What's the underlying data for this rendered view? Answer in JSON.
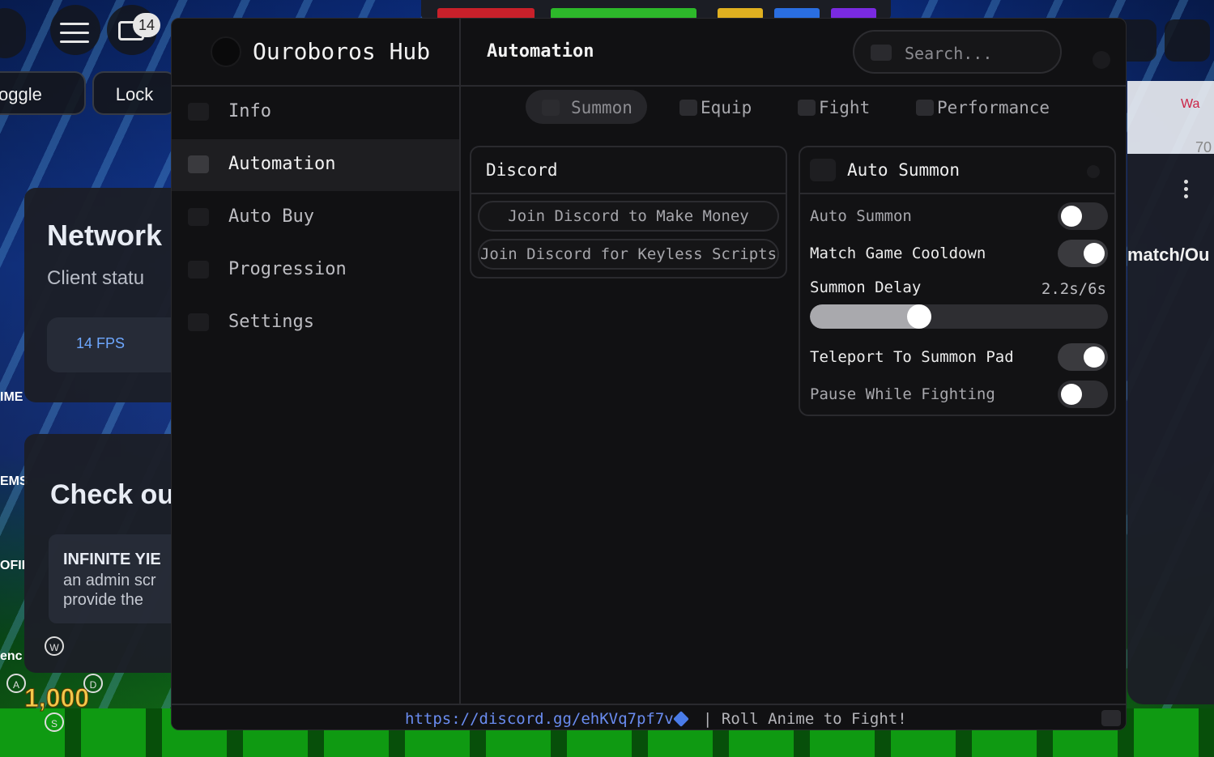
{
  "roblox": {
    "chat_badge": "14",
    "toggle_label": "oggle",
    "lock_label": "Lock",
    "network_title": "Network",
    "network_subtitle": "Client statu",
    "fps_label": "14 FPS",
    "check_title": "Check ou",
    "infinite_yield_title": "INFINITE YIE",
    "infinite_yield_line1": "an admin scr",
    "infinite_yield_line2": "provide the",
    "coins": "1,000",
    "key_w": "W",
    "key_a": "A",
    "key_d": "D",
    "key_s": "S",
    "side_label_ime": "IME",
    "side_label_ems": "EMS",
    "side_label_ofi": "OFII",
    "side_label_enc": "enc",
    "right_wa": "Wa",
    "right_70": "70",
    "right_match": "match/Ou"
  },
  "hub": {
    "title": "Ouroboros Hub",
    "page_title": "Automation",
    "search_placeholder": "Search...",
    "nav": [
      {
        "label": "Info",
        "icon": "info-icon",
        "active": false
      },
      {
        "label": "Automation",
        "icon": "automation-icon",
        "active": true
      },
      {
        "label": "Auto Buy",
        "icon": "cart-icon",
        "active": false
      },
      {
        "label": "Progression",
        "icon": "chart-icon",
        "active": false
      },
      {
        "label": "Settings",
        "icon": "gear-icon",
        "active": false
      }
    ],
    "tabs": [
      {
        "label": "Summon",
        "icon": "summon-icon",
        "active": true
      },
      {
        "label": "Equip",
        "icon": "equip-icon",
        "active": false
      },
      {
        "label": "Fight",
        "icon": "fight-icon",
        "active": false
      },
      {
        "label": "Performance",
        "icon": "performance-icon",
        "active": false
      }
    ],
    "discord": {
      "title": "Discord",
      "buttons": [
        "Join Discord to Make Money",
        "Join Discord for Keyless Scripts"
      ]
    },
    "auto_summon": {
      "title": "Auto Summon",
      "auto_summon_label": "Auto Summon",
      "auto_summon_on": false,
      "match_cooldown_label": "Match Game Cooldown",
      "match_cooldown_on": true,
      "summon_delay_label": "Summon Delay",
      "summon_delay_value": "2.2s/6s",
      "summon_delay_fraction": 0.367,
      "teleport_label": "Teleport To Summon Pad",
      "teleport_on": true,
      "pause_label": "Pause While Fighting",
      "pause_on": false
    },
    "footer": {
      "link": "https://discord.gg/ehKVq7pf7v",
      "tagline": "| Roll Anime to Fight!"
    }
  },
  "colors": {
    "accent_link": "#6a8cf0",
    "panel_bg": "#111113",
    "toggle_on": "#3a3a3e",
    "fps_text": "#6ea8ff"
  }
}
